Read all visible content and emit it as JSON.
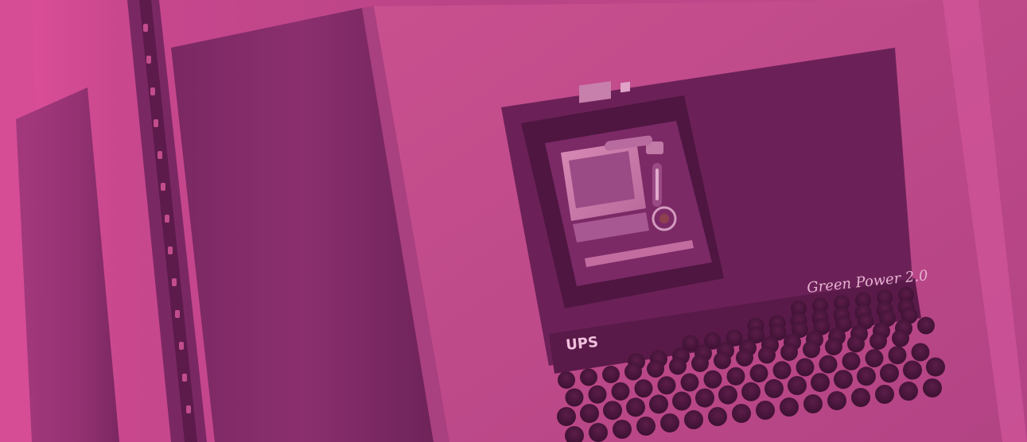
{
  "photo": {
    "subject": "ups-cabinet",
    "tint_color": "#c94a8f",
    "brand_label": "Green Power 2.0",
    "type_label": "UPS"
  }
}
